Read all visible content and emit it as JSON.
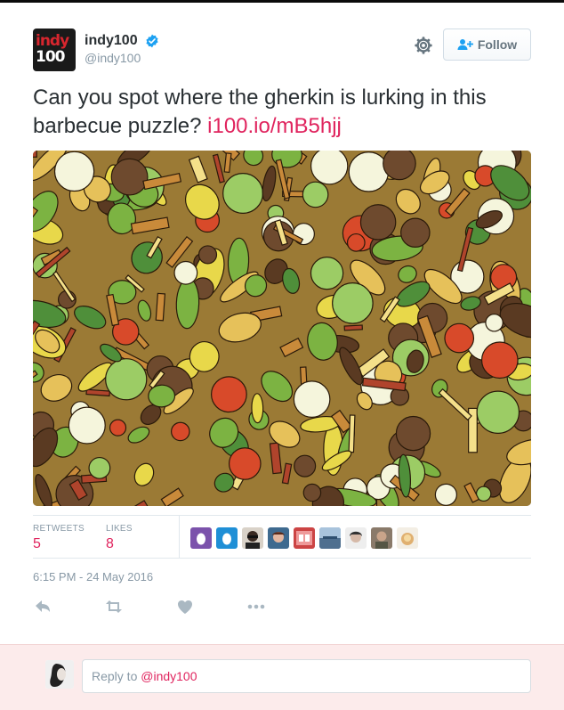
{
  "profile": {
    "name": "indy100",
    "handle": "@indy100",
    "logo_top": "indy",
    "logo_bottom": "100",
    "verified": true
  },
  "header": {
    "follow_label": "Follow",
    "gear_icon": "gear-icon",
    "follow_icon": "add-user-icon"
  },
  "tweet": {
    "text": "Can you spot where the gherkin is lurking in this barbecue puzzle? ",
    "link": "i100.io/mB5hjj",
    "image_alt": "barbecue puzzle illustration"
  },
  "stats": {
    "retweets_label": "RETWEETS",
    "retweets": "5",
    "likes_label": "LIKES",
    "likes": "8",
    "likers_count": 9
  },
  "timestamp": "6:15 PM - 24 May 2016",
  "actions": [
    "reply-icon",
    "retweet-icon",
    "heart-icon",
    "more-icon"
  ],
  "reply": {
    "prefix": "Reply to ",
    "mention": "@indy100"
  },
  "colors": {
    "accent": "#e0245e",
    "verified": "#1da1f2",
    "muted": "#8899a6",
    "reply_bg": "#fcebeb"
  }
}
